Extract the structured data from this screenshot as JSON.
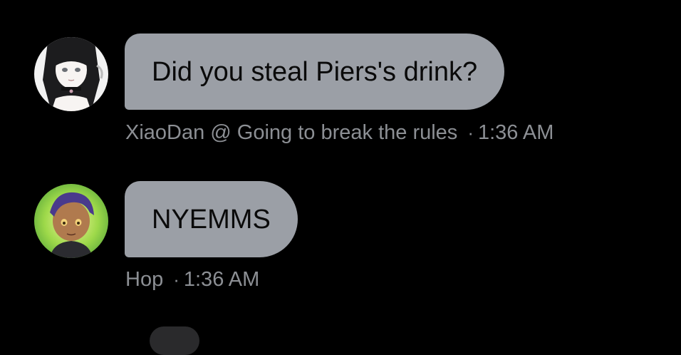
{
  "messages": [
    {
      "text": "Did you steal Piers's drink?",
      "author": "XiaoDan @ Going to break the rules",
      "separator": "·",
      "time": "1:36 AM"
    },
    {
      "text": "NYEMMS",
      "author": "Hop",
      "separator": "·",
      "time": "1:36 AM"
    }
  ],
  "colors": {
    "background": "#000000",
    "bubble": "#9b9fa6",
    "bubble_text": "#0a0a0a",
    "meta_text": "#8c8f94"
  }
}
